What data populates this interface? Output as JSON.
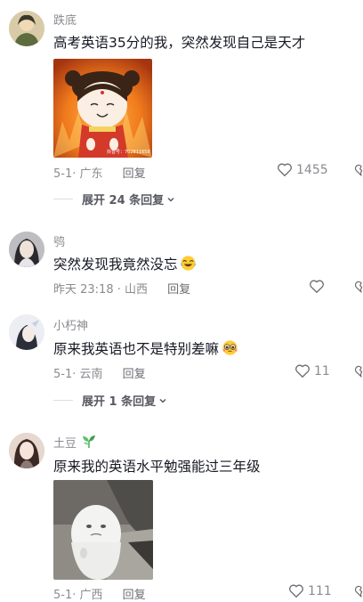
{
  "comments": [
    {
      "username": "跌底",
      "text": "高考英语35分的我，突然发现自己是天才",
      "date_location": "5-1· 广东",
      "reply_label": "回复",
      "likes": "1455",
      "expand_label": "展开 24 条回复",
      "image_watermark": "抖音号：702811658"
    },
    {
      "username": "鸮",
      "text": "突然发现我竟然没忘",
      "date_location": "昨天 23:18 · 山西",
      "reply_label": "回复",
      "likes": ""
    },
    {
      "username": "小朽神",
      "text": "原来我英语也不是特别差嘛",
      "date_location": "5-1· 云南",
      "reply_label": "回复",
      "likes": "11",
      "expand_label": "展开 1 条回复"
    },
    {
      "username": "土豆",
      "text": "原来我的英语水平勉强能过三年级",
      "date_location": "5-1· 广西",
      "reply_label": "回复",
      "likes": "111"
    }
  ],
  "icons": {
    "like": "heart-outline-icon",
    "dislike": "broken-heart-icon",
    "expand": "chevron-down-icon",
    "emoji_laugh_cry": "laugh-cry-emoji-icon",
    "emoji_pleading": "pleading-emoji-icon",
    "badge_leaf": "leaf-icon"
  },
  "colors": {
    "text_primary": "#161823",
    "text_secondary": "#8a8b91",
    "background": "#ffffff"
  }
}
